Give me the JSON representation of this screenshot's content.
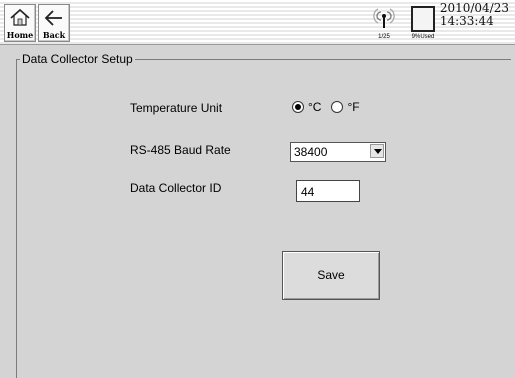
{
  "toolbar": {
    "home_label": "Home",
    "back_label": "Back",
    "signal_caption": "1/25",
    "storage_caption": "9%Used",
    "date": "2010/04/23",
    "time": "14:33:44"
  },
  "section": {
    "title": "Data Collector Setup"
  },
  "temperature": {
    "label": "Temperature Unit",
    "options": [
      "°C",
      "°F"
    ],
    "selected": "°C"
  },
  "baud": {
    "label": "RS-485 Baud Rate",
    "value": "38400"
  },
  "collector": {
    "label": "Data Collector ID",
    "value": "44"
  },
  "actions": {
    "save_label": "Save"
  },
  "icons": {
    "home": "home-icon",
    "back": "back-arrow-icon",
    "signal": "antenna-signal-icon",
    "storage": "storage-icon"
  }
}
